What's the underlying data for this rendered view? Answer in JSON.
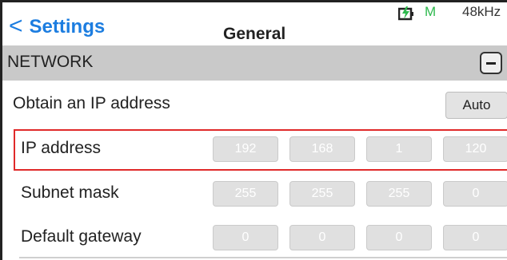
{
  "header": {
    "back_label": "Settings",
    "title": "General",
    "status": {
      "battery_icon": "battery-charging-icon",
      "mode": "M",
      "sample_rate": "48kHz",
      "mode_color": "#2db84d",
      "accent_color": "#1c7de0"
    }
  },
  "section": {
    "label": "NETWORK",
    "toggle_icon": "minus-icon"
  },
  "rows": {
    "obtain": {
      "label": "Obtain an IP address",
      "button": "Auto"
    },
    "ip": {
      "label": "IP address",
      "octets": [
        "192",
        "168",
        "1",
        "120"
      ]
    },
    "subnet": {
      "label": "Subnet mask",
      "octets": [
        "255",
        "255",
        "255",
        "0"
      ]
    },
    "gateway": {
      "label": "Default gateway",
      "octets": [
        "0",
        "0",
        "0",
        "0"
      ]
    }
  },
  "highlight_color": "#e02a2a"
}
